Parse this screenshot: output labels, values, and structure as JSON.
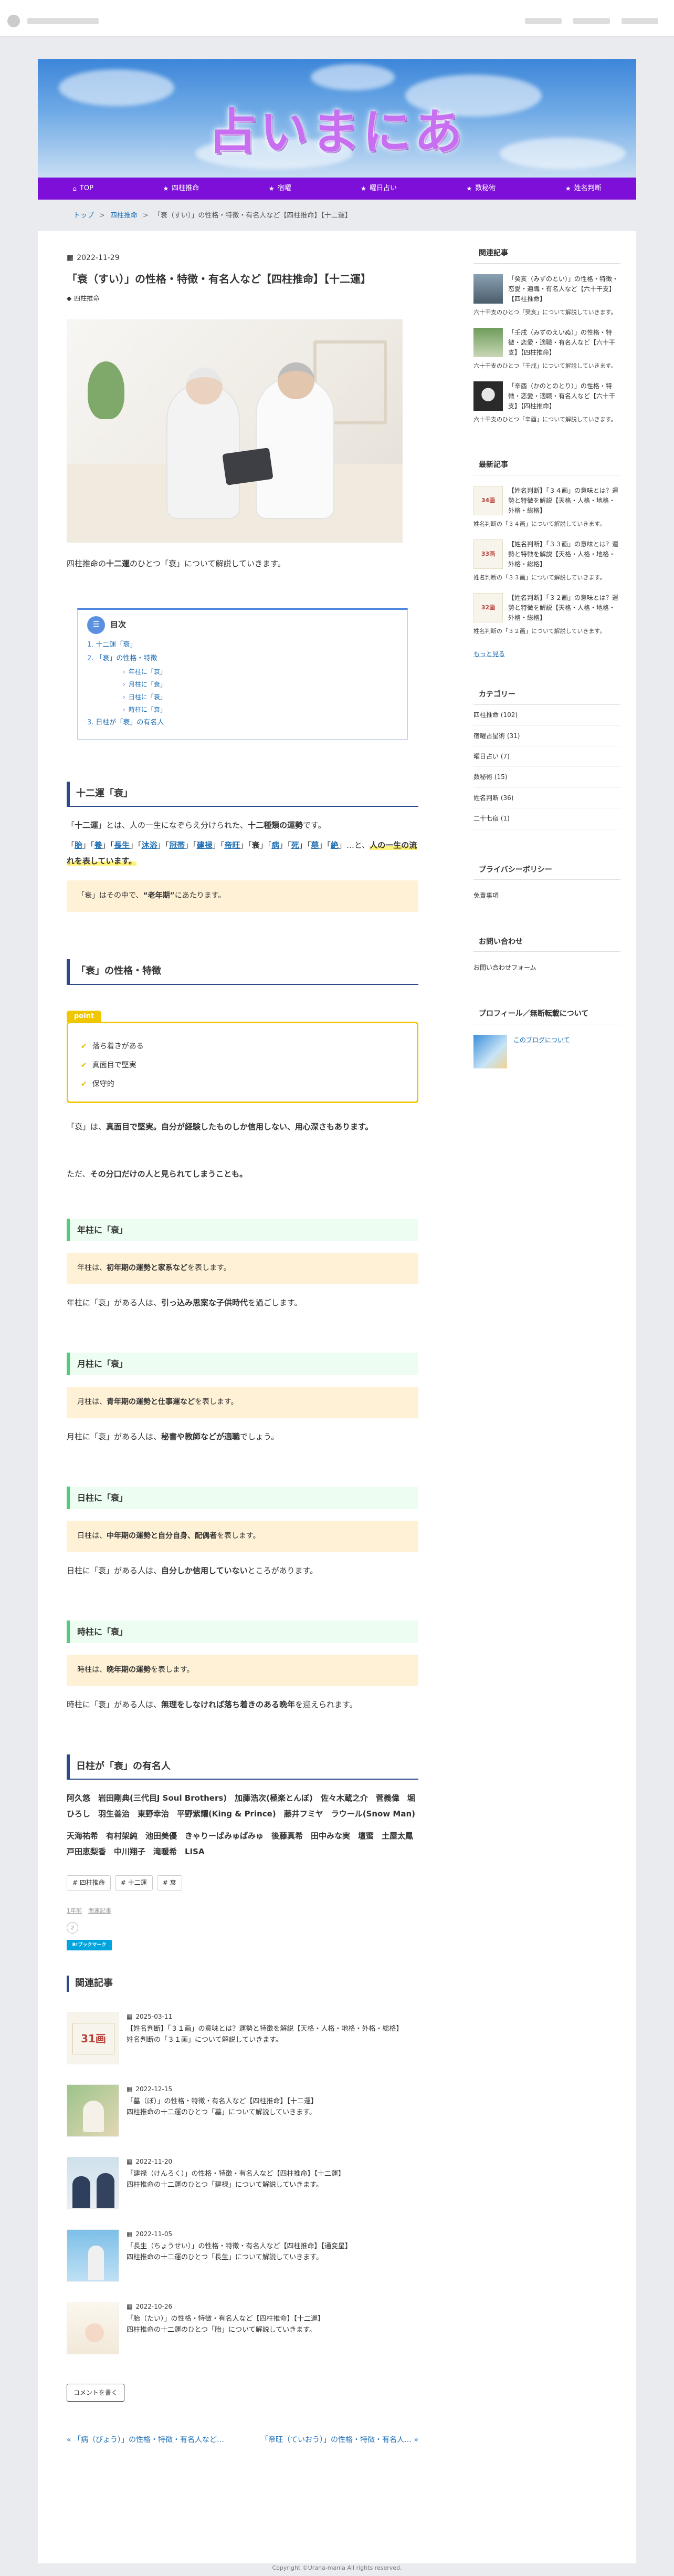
{
  "site": {
    "title": "占いまにあ",
    "nav": [
      {
        "icon": "home-icon",
        "glyph": "⌂",
        "label": "TOP"
      },
      {
        "icon": "star-icon",
        "glyph": "★",
        "label": "四柱推命"
      },
      {
        "icon": "star-icon",
        "glyph": "★",
        "label": "宿曜"
      },
      {
        "icon": "star-icon",
        "glyph": "★",
        "label": "曜日占い"
      },
      {
        "icon": "star-icon",
        "glyph": "★",
        "label": "数秘術"
      },
      {
        "icon": "star-icon",
        "glyph": "★",
        "label": "姓名判断"
      }
    ]
  },
  "breadcrumb": {
    "home": "トップ",
    "category": "四柱推命",
    "current": "「衰（すい）」の性格・特徴・有名人など【四柱推命】【十二運】"
  },
  "post": {
    "date": "2022-11-29",
    "title": "「衰（すい）」の性格・特徴・有名人など【四柱推命】【十二運】",
    "category": "四柱推命",
    "intro_pre": "四柱推命の",
    "intro_bold": "十二運",
    "intro_post": "のひとつ「衰」について解説していきます。"
  },
  "toc": {
    "title": "目次",
    "items": [
      {
        "num": "1.",
        "label": "十二運「衰」"
      },
      {
        "num": "2.",
        "label": "「衰」の性格・特徴"
      },
      {
        "num": "3.",
        "label": "日柱が「衰」の有名人"
      }
    ],
    "sub": [
      "年柱に「衰」",
      "月柱に「衰」",
      "日柱に「衰」",
      "時柱に「衰」"
    ]
  },
  "sec1": {
    "heading": "十二運「衰」",
    "p_pre": "「",
    "p_bold1": "十二運",
    "p_mid": "」とは、人の一生になぞらえ分けられた、",
    "p_bold2": "十二種類の運勢",
    "p_post": "です。",
    "signs": [
      "胎",
      "養",
      "長生",
      "沐浴",
      "冠帯",
      "建禄",
      "帝旺",
      "衰",
      "病",
      "死",
      "墓",
      "絶"
    ],
    "signs_tail": "…と、",
    "signs_mark": "人の一生の流れを表しています。",
    "note_pre": "「衰」はその中で、",
    "note_bold": "“老年期”",
    "note_post": "にあたります。"
  },
  "sec2": {
    "heading": "「衰」の性格・特徴",
    "point_label": "point",
    "points": [
      "落ち着きがある",
      "真面目で堅実",
      "保守的"
    ],
    "p1_pre": "「衰」は、",
    "p1_bold": "真面目で堅実。自分が経験したものしか信用しない、用心深さもあります。",
    "p2_pre": "ただ、",
    "p2_bold": "その分口だけの人と見られてしまうことも。"
  },
  "pillars": [
    {
      "heading": "年柱に「衰」",
      "note_pre": "年柱は、",
      "note_bold": "初年期の運勢と家系など",
      "note_post": "を表します。",
      "p_pre": "年柱に「衰」がある人は、",
      "p_bold": "引っ込み思案な子供時代",
      "p_post": "を過ごします。"
    },
    {
      "heading": "月柱に「衰」",
      "note_pre": "月柱は、",
      "note_bold": "青年期の運勢と仕事運など",
      "note_post": "を表します。",
      "p_pre": "月柱に「衰」がある人は、",
      "p_bold": "秘書や教師などが適職",
      "p_post": "でしょう。"
    },
    {
      "heading": "日柱に「衰」",
      "note_pre": "日柱は、",
      "note_bold": "中年期の運勢と自分自身、配偶者",
      "note_post": "を表します。",
      "p_pre": "日柱に「衰」がある人は、",
      "p_bold": "自分しか信用していない",
      "p_post": "ところがあります。"
    },
    {
      "heading": "時柱に「衰」",
      "note_pre": "時柱は、",
      "note_bold": "晩年期の運勢",
      "note_post": "を表します。",
      "p_pre": "時柱に「衰」がある人は、",
      "p_bold": "無理をしなければ落ち着きのある晩年",
      "p_post": "を迎えられます。"
    }
  ],
  "celebs": {
    "heading": "日柱が「衰」の有名人",
    "line1": "阿久悠　岩田剛典(三代目J Soul Brothers)　加藤浩次(極楽とんぼ)　佐々木蔵之介　菅義偉　堀ひろし　羽生善治　東野幸治　平野紫耀(King & Prince)　藤井フミヤ　ラウール(Snow Man)",
    "line2": "天海祐希　有村架純　池田美優　きゃりーぱみゅぱみゅ　後藤真希　田中みな実　壇蜜　土屋太鳳　戸田恵梨香　中川翔子　滝暖希　LISA"
  },
  "tags": [
    "四柱推命",
    "十二運",
    "衰"
  ],
  "meta": {
    "created": "1年前",
    "updated": "関連記事"
  },
  "share": {
    "hatena": "B!ブックマーク",
    "round": "2"
  },
  "related": {
    "heading": "関連記事",
    "items": [
      {
        "date": "2025-03-11",
        "title": "【姓名判断】「３１画」の意味とは？運勢と特徴を解説【天格・人格・地格・外格・総格】",
        "desc": "姓名判断の「３１画」について解説していきます。",
        "thumb": "card",
        "card_text": "31画"
      },
      {
        "date": "2022-12-15",
        "title": "「墓（ぼ）」の性格・特徴・有名人など【四柱推命】【十二運】",
        "desc": "四柱推命の十二運のひとつ「墓」について解説していきます。",
        "thumb": "photo-a"
      },
      {
        "date": "2022-11-20",
        "title": "「建禄（けんろく）」の性格・特徴・有名人など【四柱推命】【十二運】",
        "desc": "四柱推命の十二運のひとつ「建禄」について解説していきます。",
        "thumb": "photo-b"
      },
      {
        "date": "2022-11-05",
        "title": "「長生（ちょうせい）」の性格・特徴・有名人など【四柱推命】【通変星】",
        "desc": "四柱推命の十二運のひとつ「長生」について解説していきます。",
        "thumb": "photo-c"
      },
      {
        "date": "2022-10-26",
        "title": "「胎（たい）」の性格・特徴・有名人など【四柱推命】【十二運】",
        "desc": "四柱推命の十二運のひとつ「胎」について解説していきます。",
        "thumb": "photo-d"
      }
    ]
  },
  "comment_button": "コメントを書く",
  "prev": "« 「病（びょう）」の性格・特徴・有名人など…",
  "next": "「帝旺（ていおう）」の性格・特徴・有名人… »",
  "sidebar": {
    "related_heading": "関連記事",
    "related": [
      {
        "title": "「癸亥（みずのとい）」の性格・特徴・恋愛・適職・有名人など【六十干支】【四柱推命】",
        "cap": "六十干支のひとつ「癸亥」について解説していきます。"
      },
      {
        "title": "「壬戌（みずのえいぬ）」の性格・特徴・恋愛・適職・有名人など【六十干支】【四柱推命】",
        "cap": "六十干支のひとつ「壬戌」について解説していきます。"
      },
      {
        "title": "「辛酉（かのとのとり）」の性格・特徴・恋愛・適職・有名人など【六十干支】【四柱推命】",
        "cap": "六十干支のひとつ「辛酉」について解説していきます。"
      }
    ],
    "latest_heading": "最新記事",
    "latest": [
      {
        "title": "【姓名判断】「３４画」の意味とは？運勢と特徴を解説【天格・人格・地格・外格・総格】",
        "cap": "姓名判断の「３４画」について解説していきます。",
        "card_text": "34画"
      },
      {
        "title": "【姓名判断】「３３画」の意味とは？運勢と特徴を解説【天格・人格・地格・外格・総格】",
        "cap": "姓名判断の「３３画」について解説していきます。",
        "card_text": "33画"
      },
      {
        "title": "【姓名判断】「３２画」の意味とは？運勢と特徴を解説【天格・人格・地格・外格・総格】",
        "cap": "姓名判断の「３２画」について解説していきます。",
        "card_text": "32画"
      }
    ],
    "more": "もっと見る",
    "category_heading": "カテゴリー",
    "categories": [
      "四柱推命 (102)",
      "宿曜占星術 (31)",
      "曜日占い (7)",
      "数秘術 (15)",
      "姓名判断 (36)",
      "二十七宿 (1)"
    ],
    "privacy_heading": "プライバシーポリシー",
    "privacy": "免責事項",
    "contact_heading": "お問い合わせ",
    "contact": "お問い合わせフォーム",
    "profile_heading": "プロフィール／無断転載について",
    "profile_link": "このブログについて"
  },
  "footer": "Copyright ©Urana-mania All rights reserved."
}
